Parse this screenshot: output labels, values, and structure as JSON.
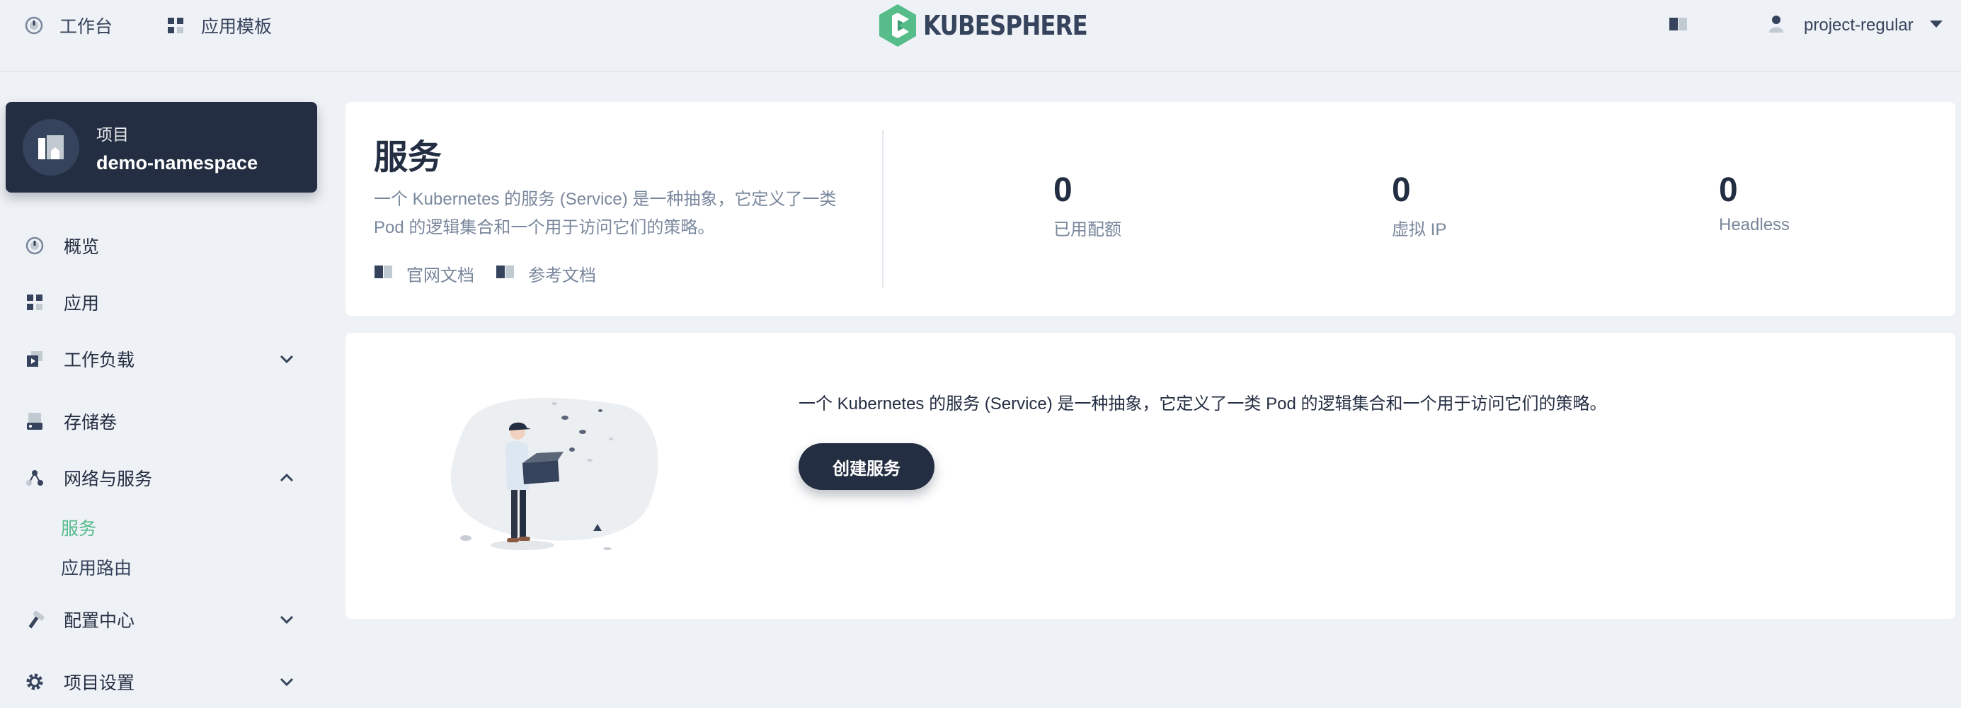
{
  "topnav": {
    "workbench_label": "工作台",
    "app_templates_label": "应用模板",
    "logo_text": "KUBESPHERE",
    "username": "project-regular"
  },
  "sidebar": {
    "project_kind": "项目",
    "project_name": "demo-namespace",
    "items": [
      {
        "label": "概览",
        "icon": "dashboard-icon"
      },
      {
        "label": "应用",
        "icon": "appcenter-icon"
      },
      {
        "label": "工作负载",
        "icon": "backup-icon"
      },
      {
        "label": "存储卷",
        "icon": "storage-icon"
      },
      {
        "label": "网络与服务",
        "icon": "network-icon"
      },
      {
        "label": "配置中心",
        "icon": "hammer-icon"
      },
      {
        "label": "项目设置",
        "icon": "gear-icon"
      }
    ],
    "sub_items": [
      {
        "label": "服务",
        "active": true
      },
      {
        "label": "应用路由",
        "active": false
      }
    ]
  },
  "banner": {
    "title": "服务",
    "description": "一个 Kubernetes 的服务 (Service) 是一种抽象，它定义了一类 Pod 的逻辑集合和一个用于访问它们的策略。",
    "links": [
      "官网文档",
      "参考文档"
    ],
    "stats": [
      {
        "value": "0",
        "label": "已用配额"
      },
      {
        "value": "0",
        "label": "虚拟 IP"
      },
      {
        "value": "0",
        "label": "Headless"
      }
    ]
  },
  "empty_state": {
    "message": "一个 Kubernetes 的服务 (Service) 是一种抽象，它定义了一类 Pod 的逻辑集合和一个用于访问它们的策略。",
    "create_button": "创建服务"
  },
  "colors": {
    "dark": "#242e42",
    "accent_green": "#55bc8a",
    "muted_text": "#79879c",
    "background": "#eef1f5"
  }
}
